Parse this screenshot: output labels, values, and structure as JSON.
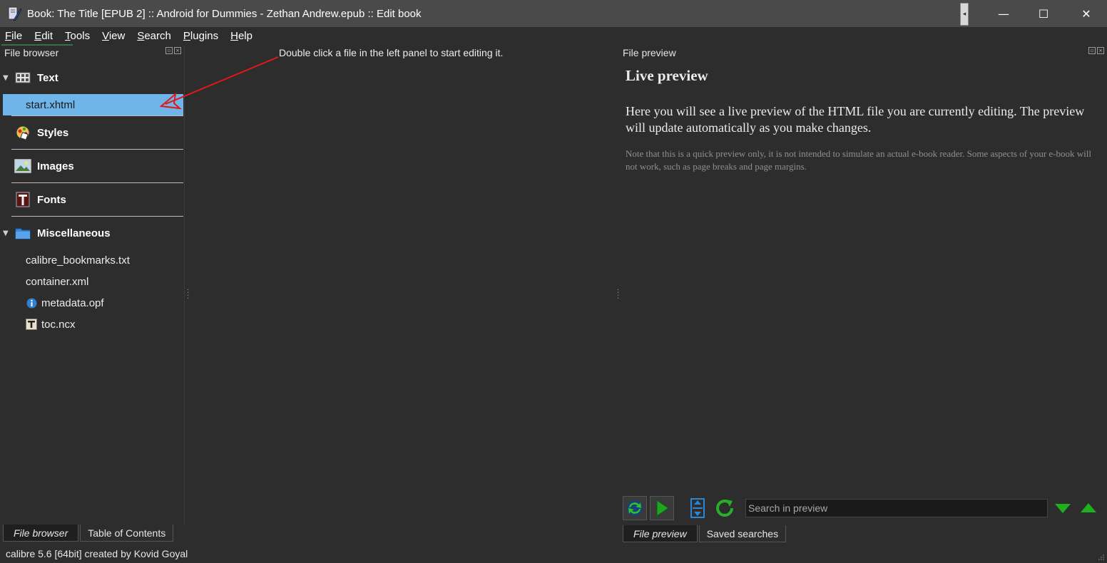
{
  "window": {
    "title": "Book: The Title [EPUB 2] :: Android for Dummies - Zethan Andrew.epub :: Edit book",
    "minimize_glyph": "—",
    "maximize_glyph": "☐",
    "close_glyph": "✕"
  },
  "menu": [
    {
      "acc": "F",
      "rest": "ile"
    },
    {
      "acc": "E",
      "rest": "dit"
    },
    {
      "acc": "T",
      "rest": "ools"
    },
    {
      "acc": "V",
      "rest": "iew"
    },
    {
      "acc": "S",
      "rest": "earch"
    },
    {
      "acc": "P",
      "rest": "lugins"
    },
    {
      "acc": "H",
      "rest": "elp"
    }
  ],
  "file_browser": {
    "title": "File browser",
    "categories": {
      "text": "Text",
      "styles": "Styles",
      "images": "Images",
      "fonts": "Fonts",
      "misc": "Miscellaneous"
    },
    "text_files": [
      "start.xhtml"
    ],
    "misc_files": [
      "calibre_bookmarks.txt",
      "container.xml",
      "metadata.opf",
      "toc.ncx"
    ],
    "tabs": [
      "File browser",
      "Table of Contents"
    ]
  },
  "center": {
    "hint": "Double click a file in the left panel to start editing it."
  },
  "preview": {
    "title": "File preview",
    "heading": "Live preview",
    "paragraph": "Here you will see a live preview of the HTML file you are currently editing. The preview will update automatically as you make changes.",
    "note": "Note that this is a quick preview only, it is not intended to simulate an actual e-book reader. Some aspects of your e-book will not work, such as page breaks and page margins.",
    "search_placeholder": "Search in preview",
    "tabs": [
      "File preview",
      "Saved searches"
    ]
  },
  "status": {
    "text": "calibre 5.6 [64bit] created by Kovid Goyal"
  },
  "icons": {
    "app": "calibre-edit-icon",
    "sync": "sync-icon",
    "play": "play-icon",
    "split": "split-icon",
    "refresh": "refresh-icon",
    "down": "find-next-icon",
    "up": "find-previous-icon"
  },
  "colors": {
    "selection": "#6fb5ea",
    "annotation_arrow": "#e01818",
    "accent_green": "#1fa51f"
  }
}
